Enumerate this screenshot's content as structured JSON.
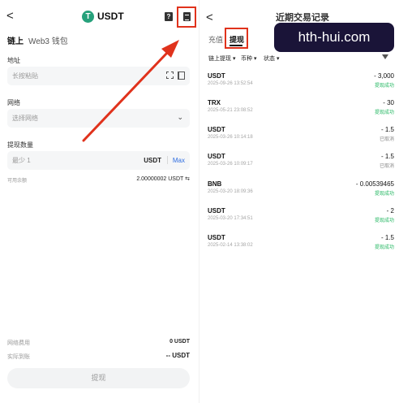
{
  "left": {
    "back_glyph": "<",
    "coin_logo": "T",
    "title": "USDT",
    "help_glyph": "?",
    "tabs": [
      "链上",
      "Web3 钱包"
    ],
    "address": {
      "label": "地址",
      "placeholder": "长按粘贴"
    },
    "network": {
      "label": "网络",
      "placeholder": "选择网络",
      "chevron": "⌄"
    },
    "amount": {
      "label": "提现数量",
      "placeholder": "最少 1",
      "unit": "USDT",
      "max": "Max"
    },
    "available": {
      "label": "可用余额",
      "value": "2.00000002 USDT ⇆"
    },
    "fee": {
      "label": "网络费用",
      "value": "0 USDT"
    },
    "receive": {
      "label": "实际到账",
      "value": "-- USDT"
    },
    "submit_label": "提现"
  },
  "right": {
    "back_glyph": "<",
    "title": "近期交易记录",
    "tabs": [
      "充值",
      "提现"
    ],
    "filters": [
      "链上提现 ▾",
      "币种 ▾",
      "状态 ▾"
    ],
    "transactions": [
      {
        "coin": "USDT",
        "time": "2025-09-26 13:52:54",
        "amount": "- 3,000",
        "status": "提现成功",
        "status_color": "#27b864"
      },
      {
        "coin": "TRX",
        "time": "2025-05-21 23:08:52",
        "amount": "- 30",
        "status": "提现成功",
        "status_color": "#27b864"
      },
      {
        "coin": "USDT",
        "time": "2025-03-26 10:14:18",
        "amount": "- 1.5",
        "status": "已取消",
        "status_color": "#888888"
      },
      {
        "coin": "USDT",
        "time": "2025-03-26 10:09:17",
        "amount": "- 1.5",
        "status": "已取消",
        "status_color": "#888888"
      },
      {
        "coin": "BNB",
        "time": "2025-03-20 18:09:36",
        "amount": "- 0.00539465",
        "status": "提现成功",
        "status_color": "#27b864"
      },
      {
        "coin": "USDT",
        "time": "2025-03-20 17:34:51",
        "amount": "- 2",
        "status": "提现成功",
        "status_color": "#27b864"
      },
      {
        "coin": "USDT",
        "time": "2025-02-14 13:38:02",
        "amount": "- 1.5",
        "status": "提现成功",
        "status_color": "#27b864"
      }
    ]
  },
  "banner_text": "hth-hui.com",
  "colors": {
    "highlight": "#e0321c",
    "tether": "#26a17b",
    "link": "#2f6de0",
    "success": "#27b864"
  }
}
